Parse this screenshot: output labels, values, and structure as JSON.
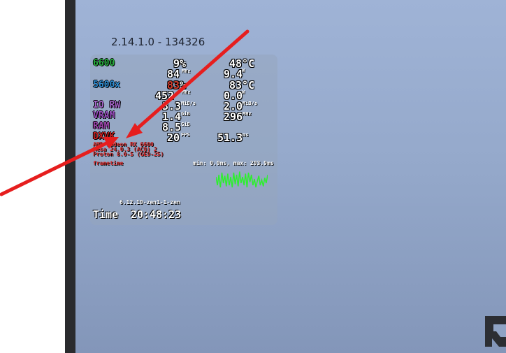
{
  "overlay": {
    "version": "2.14.1.0 - 134326",
    "gpu": {
      "label": "6600",
      "load": "9%",
      "temp": "48°C",
      "clock": "84",
      "clock_unit": "MHz",
      "power": "9.4",
      "power_unit": "W"
    },
    "cpu": {
      "label": "5600x",
      "load": "83",
      "load_suffix": "%",
      "temp": "83°C",
      "clock": "452",
      "clock_unit": "MHz",
      "power": "0.0",
      "power_unit": "W"
    },
    "io": {
      "label": "IO RW",
      "read": "3.3",
      "read_unit": "MiB/s",
      "write": "2.0",
      "write_unit": "MiB/s"
    },
    "vram": {
      "label": "VRAM",
      "used": "1.4",
      "used_unit": "GiB",
      "clock": "296",
      "clock_unit": "MHz"
    },
    "ram": {
      "label": "RAM",
      "used": "8.5",
      "used_unit": "GiB"
    },
    "dxvk": {
      "label": "DXVK",
      "fps": "20",
      "fps_unit": "FPS",
      "frametime": "51.3",
      "frametime_unit": "ms"
    },
    "info_lines": [
      "AMD Radeon RX 6600",
      "Mesa 24.0.3 (ACO) 2",
      "Proton 8.0-5 (GE9-25)"
    ],
    "frametime_label": "frametime",
    "frametime_range": "min: 0.0ms, max: 203.9ms",
    "frametime_graph": [
      0.7,
      0.3,
      0.8,
      0.2,
      0.9,
      0.4,
      0.75,
      0.25,
      0.85,
      0.3,
      0.7,
      0.2,
      0.9,
      0.35,
      0.8,
      0.25,
      0.95,
      0.4,
      0.7,
      0.3,
      0.85,
      0.2,
      0.9,
      0.45,
      0.8,
      0.3,
      0.6,
      0.2,
      0.5,
      0.75,
      0.3,
      0.55,
      0.25,
      0.65,
      0.4,
      0.8
    ],
    "kernel": "6.12.10-zen1-1-zen",
    "time_label": "Time",
    "time_value": "20:48:23"
  },
  "colors": {
    "gpu": "#28b040",
    "cpu": "#2f8fd6",
    "io": "#a565c8",
    "vram": "#9a4fbf",
    "ram": "#a046b0",
    "dxvk": "#c82020",
    "cpu_load": "#d63c2c",
    "graph": "#2cf02c",
    "arrow": "#e61e1e"
  },
  "icons": {
    "corner": "app-corner-icon"
  }
}
